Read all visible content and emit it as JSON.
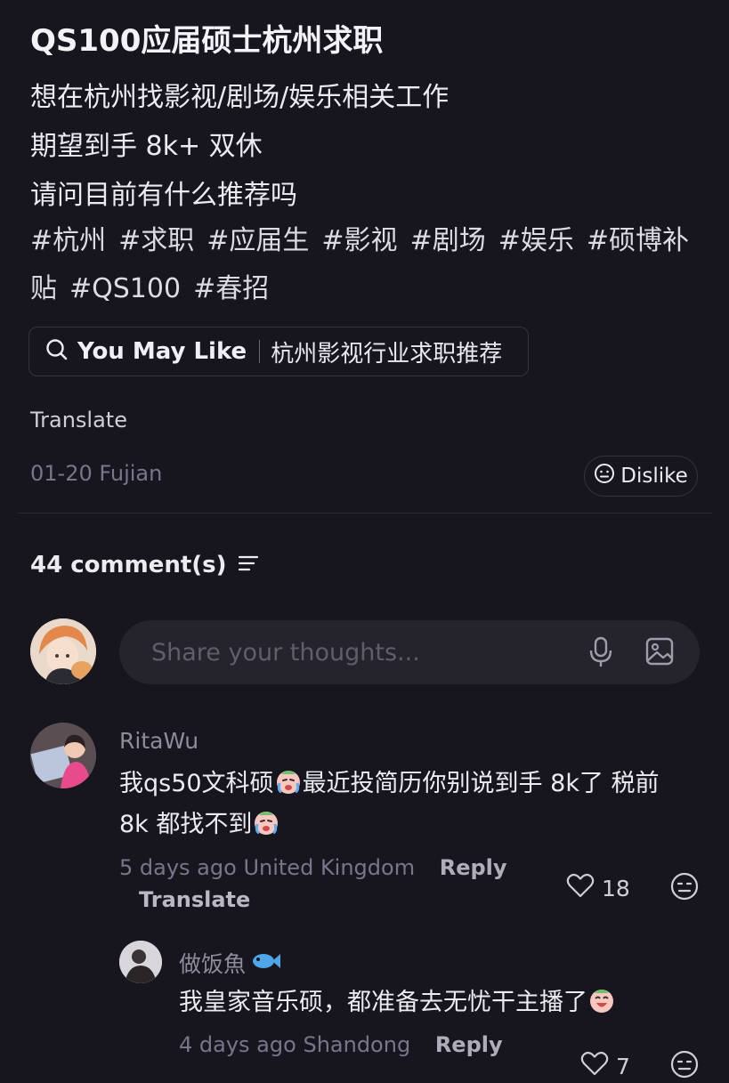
{
  "post": {
    "title": "QS100应届硕士杭州求职",
    "lines": [
      "想在杭州找影视/剧场/娱乐相关工作",
      "期望到手 8k+ 双休",
      "请问目前有什么推荐吗"
    ],
    "hashtags": [
      "#杭州",
      "#求职",
      "#应届生",
      "#影视",
      "#剧场",
      "#娱乐",
      "#硕博补贴",
      "#QS100",
      "#春招"
    ],
    "you_may_like": {
      "label": "You May Like",
      "topic": "杭州影视行业求职推荐"
    },
    "translate_label": "Translate",
    "meta": "01-20 Fujian",
    "dislike_label": "Dislike"
  },
  "comments_header": {
    "count_label": "44 comment(s)"
  },
  "composer": {
    "placeholder": "Share your thoughts..."
  },
  "comments": [
    {
      "username": "RitaWu",
      "text_part1": "我qs50文科硕",
      "text_part2": "最近投简历你别说到手 8k了 税前",
      "text_part3": " 8k 都找不到",
      "time": "5 days ago",
      "location": "United Kingdom",
      "reply_label": "Reply",
      "translate_label": "Translate",
      "likes": "18"
    },
    {
      "username": "做饭魚",
      "text": "我皇家音乐硕，都准备去无忧干主播了",
      "time": "4 days ago",
      "location": "Shandong",
      "reply_label": "Reply",
      "likes": "7"
    }
  ],
  "colors": {
    "background": "#17161f",
    "text": "#ecebf0",
    "muted": "#77768a",
    "input_bg": "#25242d"
  }
}
